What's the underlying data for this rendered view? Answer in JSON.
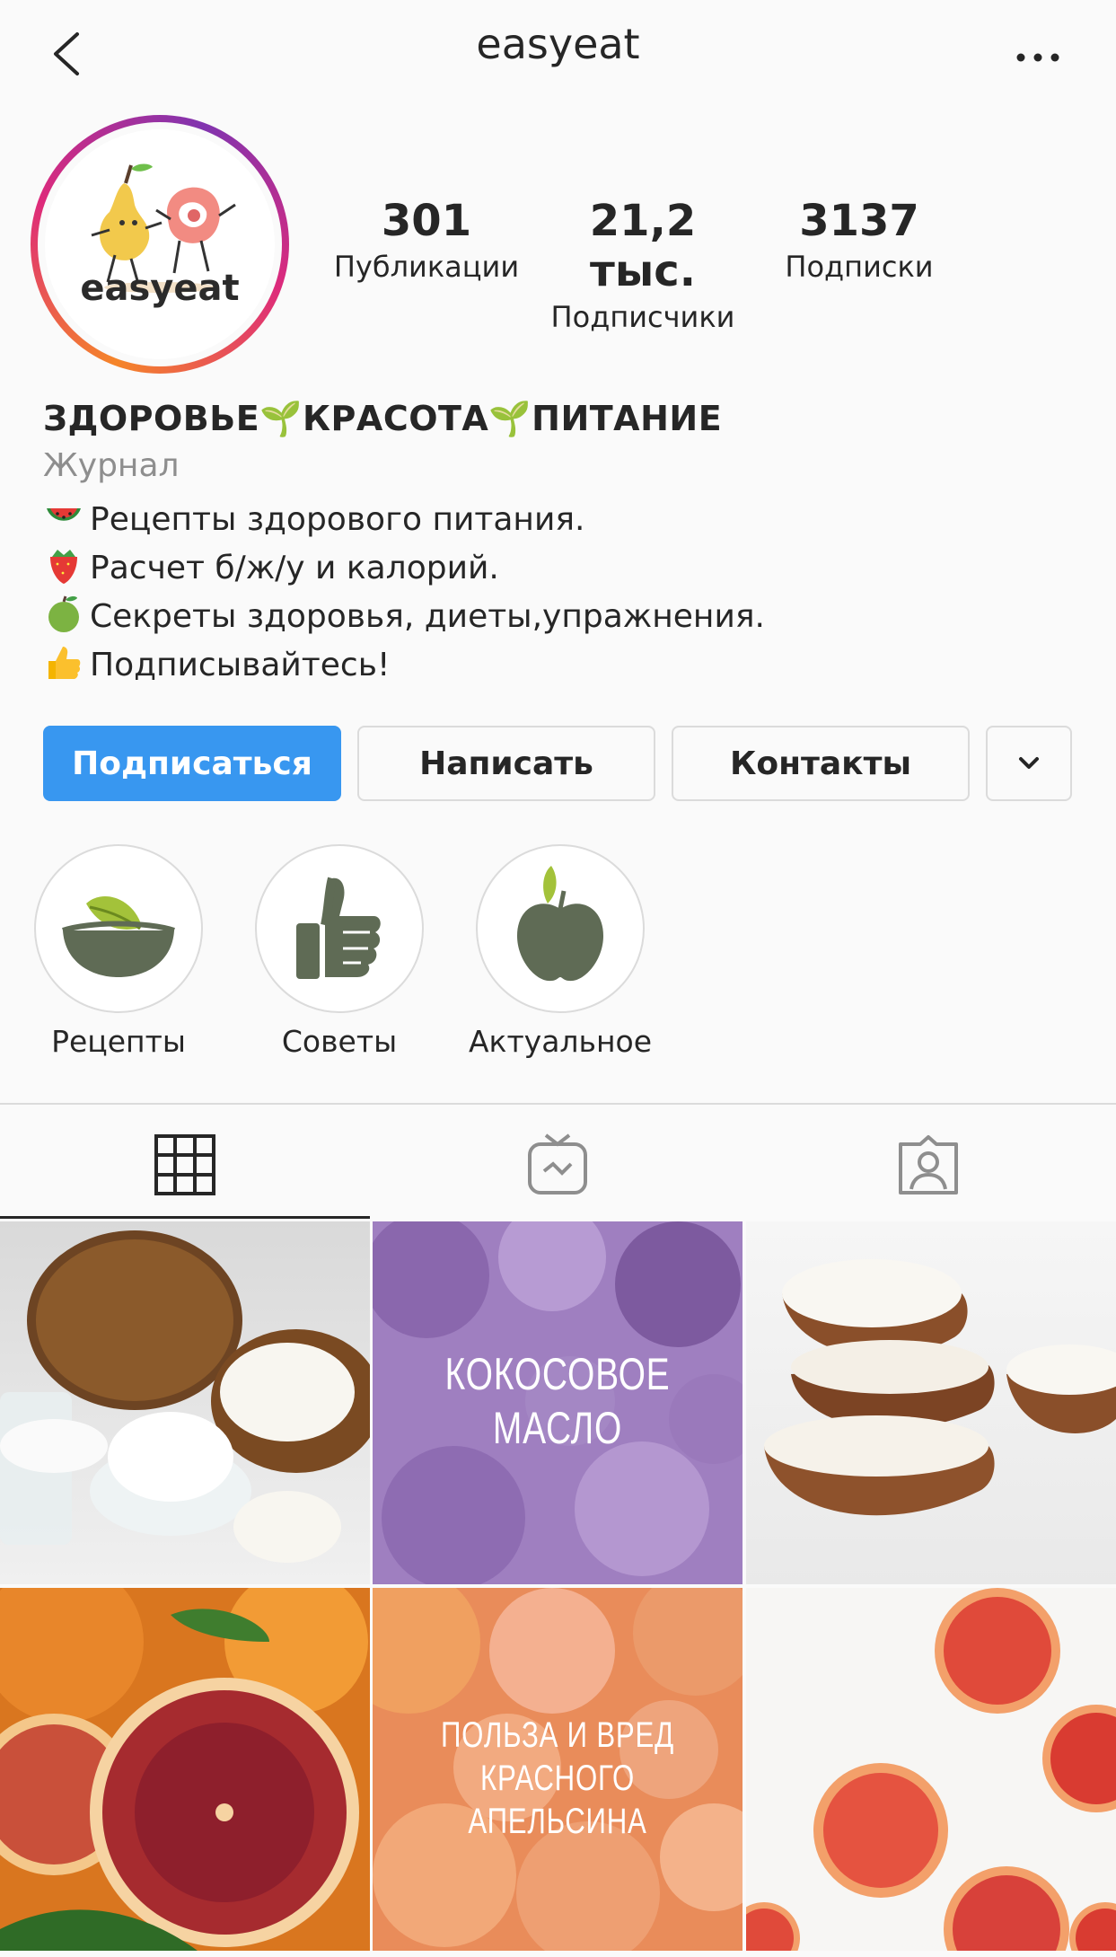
{
  "header": {
    "title": "easyeat",
    "back_icon": "chevron-left-icon",
    "more_icon": "more-horizontal-icon"
  },
  "profile": {
    "avatar_text": "easyeat",
    "stats": [
      {
        "value": "301",
        "label": "Публикации"
      },
      {
        "value": "21,2 тыс.",
        "label": "Подписчики"
      },
      {
        "value": "3137",
        "label": "Подписки"
      }
    ],
    "bio": {
      "title": "ЗДОРОВЬЕ🌱КРАСОТА🌱ПИТАНИЕ",
      "category": "Журнал",
      "lines": [
        {
          "emoji": "watermelon",
          "text": "Рецепты здорового питания."
        },
        {
          "emoji": "strawberry",
          "text": "Расчет б/ж/у и калорий."
        },
        {
          "emoji": "green-apple",
          "text": "Секреты здоровья, диеты,упражнения."
        },
        {
          "emoji": "thumbs-up",
          "text": "Подписывайтесь!"
        }
      ]
    }
  },
  "actions": {
    "follow": "Подписаться",
    "message": "Написать",
    "contacts": "Контакты",
    "dropdown_icon": "chevron-down-icon"
  },
  "highlights": [
    {
      "label": "Рецепты",
      "icon": "bowl-leaf-icon"
    },
    {
      "label": "Советы",
      "icon": "thumbs-up-icon"
    },
    {
      "label": "Актуальное",
      "icon": "apple-icon"
    }
  ],
  "tabs": [
    {
      "name": "grid",
      "icon": "grid-icon",
      "active": true
    },
    {
      "name": "igtv",
      "icon": "igtv-icon",
      "active": false
    },
    {
      "name": "tagged",
      "icon": "tagged-user-icon",
      "active": false
    }
  ],
  "posts": [
    {
      "caption": ""
    },
    {
      "caption_line1": "КОКОСОВОЕ",
      "caption_line2": "МАСЛО"
    },
    {
      "caption": ""
    },
    {
      "caption": ""
    },
    {
      "caption_line1": "ПОЛЬЗА И ВРЕД",
      "caption_line2": "КРАСНОГО АПЕЛЬСИНА"
    },
    {
      "caption": ""
    }
  ],
  "colors": {
    "primary": "#3897f0",
    "text": "#262626",
    "muted": "#8e8e8e",
    "border": "#dbdbdb",
    "highlight_icon": "#5f6b55"
  }
}
